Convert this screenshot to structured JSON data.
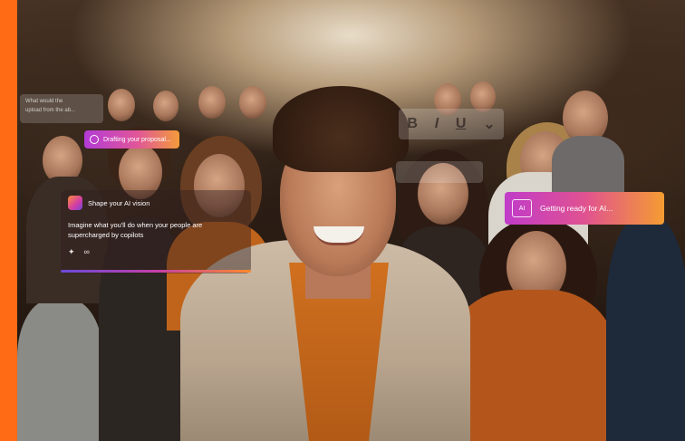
{
  "overlays": {
    "ghost_lines": [
      "What would the",
      "upload from the ab..."
    ],
    "toolbar_glyphs": [
      "B",
      "I",
      "U",
      "⌄"
    ],
    "draft_label": "Drafting your proposal...",
    "vision_title": "Shape your AI vision",
    "vision_prompt": "Imagine what you'll do when your people are supercharged by copilots",
    "ready_label": "Getting ready for AI...",
    "ai_badge": "AI"
  },
  "colors": {
    "accent": "#ff6a14",
    "gradient_start": "#c03bc9",
    "gradient_end": "#f49c32"
  }
}
